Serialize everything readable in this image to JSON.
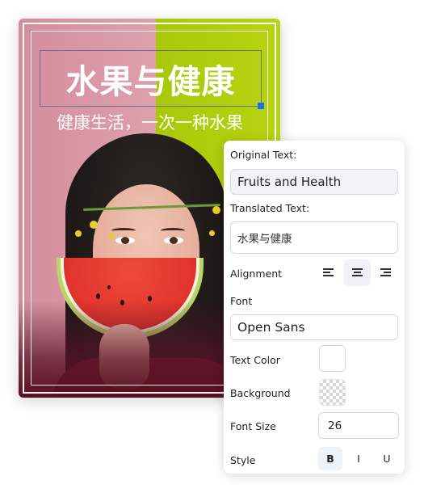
{
  "poster": {
    "title": "水果与健康",
    "subtitle": "健康生活，一次一种水果",
    "colors": {
      "left_background": "#d48d9c",
      "right_background": "#a8c80a",
      "text": "#ffffff",
      "selection_border": "#6a7285",
      "selection_handle": "#1d6ff2"
    }
  },
  "panel": {
    "original_text": {
      "label": "Original Text:",
      "value": "Fruits and Health"
    },
    "translated_text": {
      "label": "Translated Text:",
      "value": "水果与健康"
    },
    "alignment": {
      "label": "Alignment",
      "options": [
        {
          "name": "align-left",
          "icon": "align-left-icon",
          "active": false
        },
        {
          "name": "align-center",
          "icon": "align-center-icon",
          "active": true
        },
        {
          "name": "align-right",
          "icon": "align-right-icon",
          "active": false
        }
      ]
    },
    "font": {
      "label": "Font",
      "value": "Open Sans"
    },
    "text_color": {
      "label": "Text Color",
      "value": "#ffffff"
    },
    "background": {
      "label": "Background",
      "value": "transparent"
    },
    "font_size": {
      "label": "Font Size",
      "value": "26"
    },
    "style": {
      "label": "Style",
      "options": [
        {
          "label": "B",
          "name": "bold",
          "active": true
        },
        {
          "label": "I",
          "name": "italic",
          "active": false
        },
        {
          "label": "U",
          "name": "underline",
          "active": false
        }
      ]
    }
  }
}
